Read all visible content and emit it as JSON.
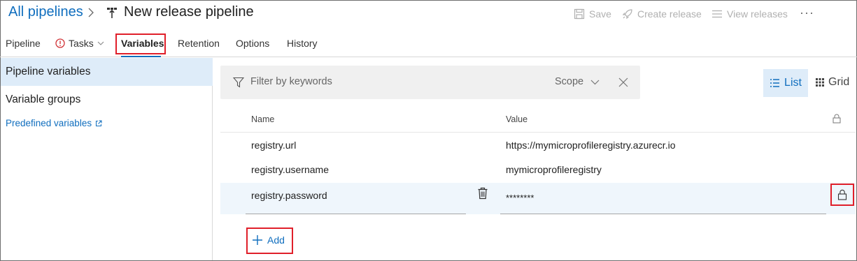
{
  "header": {
    "breadcrumb": "All pipelines",
    "title": "New release pipeline",
    "save_label": "Save",
    "create_release_label": "Create release",
    "view_releases_label": "View releases",
    "more_label": "···"
  },
  "tabs": [
    {
      "label": "Pipeline"
    },
    {
      "label": "Tasks"
    },
    {
      "label": "Variables"
    },
    {
      "label": "Retention"
    },
    {
      "label": "Options"
    },
    {
      "label": "History"
    }
  ],
  "sidebar": {
    "items": [
      {
        "label": "Pipeline variables"
      },
      {
        "label": "Variable groups"
      }
    ],
    "link_label": "Predefined variables"
  },
  "filter": {
    "placeholder": "Filter by keywords",
    "scope_label": "Scope"
  },
  "view": {
    "list_label": "List",
    "grid_label": "Grid"
  },
  "table": {
    "headers": {
      "name": "Name",
      "value": "Value"
    },
    "rows": [
      {
        "name": "registry.url",
        "value": "https://mymicroprofileregistry.azurecr.io"
      },
      {
        "name": "registry.username",
        "value": "mymicroprofileregistry"
      },
      {
        "name": "registry.password",
        "value": "********"
      }
    ]
  },
  "add_label": "Add",
  "colors": {
    "accent": "#106ebe",
    "selected_bg": "#deecf9",
    "highlight_border": "#e01f2a"
  }
}
